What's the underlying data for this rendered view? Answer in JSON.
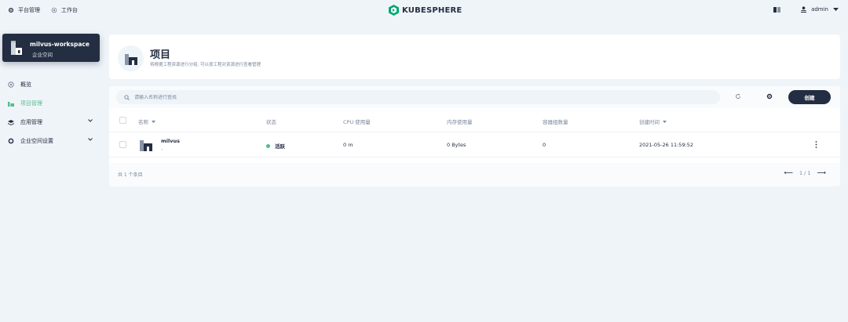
{
  "topnav": {
    "platform_label": "平台管理",
    "workbench_label": "工作台"
  },
  "brand": {
    "name": "KUBESPHERE"
  },
  "user": {
    "name": "admin"
  },
  "workspace": {
    "name": "milvus-workspace",
    "type": "企业空间"
  },
  "sidebar": {
    "items": [
      {
        "label": "概览",
        "icon": "dashboard-icon"
      },
      {
        "label": "项目管理",
        "icon": "project-icon",
        "active": true
      },
      {
        "label": "应用管理",
        "icon": "app-icon",
        "expandable": true
      },
      {
        "label": "企业空间设置",
        "icon": "gear-icon",
        "expandable": true
      }
    ]
  },
  "header": {
    "title": "项目",
    "description": "将根据工程资源进行分组, 可以按工程对资源进行查看管理"
  },
  "toolbar": {
    "search_placeholder": "请输入名称进行查找",
    "create_label": "创建"
  },
  "table": {
    "columns": [
      "名称",
      "状态",
      "CPU 使用量",
      "内存使用量",
      "容器组数量",
      "创建时间"
    ],
    "rows": [
      {
        "name": "milvus",
        "subtitle": "-",
        "status": "活跃",
        "cpu": "0 m",
        "memory": "0 Bytes",
        "pods": "0",
        "created": "2021-05-26 11:59:52"
      }
    ],
    "total": "共 1 个条目",
    "page": "1 / 1"
  },
  "colors": {
    "accent": "#55bc8a",
    "dark": "#242e42",
    "background": "#eff4f9"
  }
}
